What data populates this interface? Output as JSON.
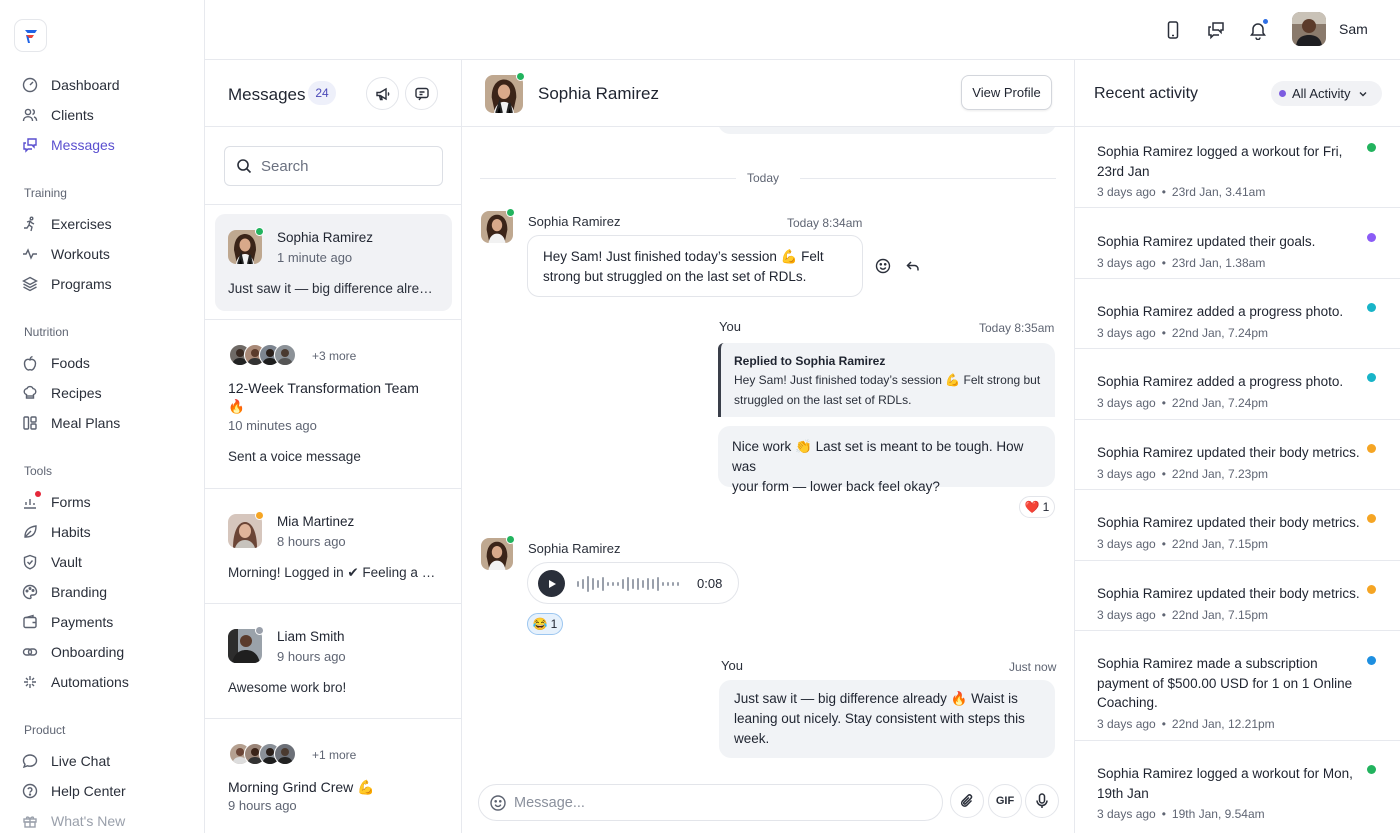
{
  "app": {
    "user_name": "Sam"
  },
  "sidebar": {
    "main": [
      {
        "label": "Dashboard"
      },
      {
        "label": "Clients"
      },
      {
        "label": "Messages"
      }
    ],
    "sections": [
      {
        "title": "Training",
        "items": [
          {
            "label": "Exercises"
          },
          {
            "label": "Workouts"
          },
          {
            "label": "Programs"
          }
        ]
      },
      {
        "title": "Nutrition",
        "items": [
          {
            "label": "Foods"
          },
          {
            "label": "Recipes"
          },
          {
            "label": "Meal Plans"
          }
        ]
      },
      {
        "title": "Tools",
        "items": [
          {
            "label": "Forms"
          },
          {
            "label": "Habits"
          },
          {
            "label": "Vault"
          },
          {
            "label": "Branding"
          },
          {
            "label": "Payments"
          },
          {
            "label": "Onboarding"
          },
          {
            "label": "Automations"
          }
        ]
      },
      {
        "title": "Product",
        "items": [
          {
            "label": "Live Chat"
          },
          {
            "label": "Help Center"
          },
          {
            "label": "What's New"
          }
        ]
      }
    ]
  },
  "messages_panel": {
    "title": "Messages",
    "count": "24",
    "search_placeholder": "Search",
    "conversations": [
      {
        "name": "Sophia Ramirez",
        "time": "1 minute ago",
        "snippet": "Just saw it — big difference already 🔥 Waist is leaning out nicely.",
        "status_color": "#22b35e"
      },
      {
        "more": "+3 more",
        "name": "12-Week Transformation Team",
        "emoji": "🔥",
        "time": "10 minutes ago",
        "snippet": "Sent a voice message"
      },
      {
        "name": "Mia Martinez",
        "time": "8 hours ago",
        "snippet": "Morning! Logged in ✔ Feeling a bit sore today.",
        "status_color": "#f5a524"
      },
      {
        "name": "Liam Smith",
        "time": "9 hours ago",
        "snippet": "Awesome work bro!",
        "status_color": "#9aa0ab"
      },
      {
        "more": "+1 more",
        "name": "Morning Grind Crew 💪",
        "time": "9 hours ago",
        "snippet": ""
      }
    ]
  },
  "chat": {
    "contact_name": "Sophia Ramirez",
    "view_profile_label": "View Profile",
    "day_label": "Today",
    "messages": [
      {
        "sender": "Sophia Ramirez",
        "time": "Today 8:34am",
        "line1": "Hey Sam! Just finished today’s session 💪 Felt",
        "line2": "strong but struggled on the last set of RDLs."
      },
      {
        "sender": "You",
        "time": "Today 8:35am",
        "reply_title": "Replied to Sophia Ramirez",
        "reply_line1": "Hey Sam! Just finished today’s session 💪 Felt strong but",
        "reply_line2": "struggled on the last set of RDLs.",
        "line1": "Nice work 👏 Last set is meant to be tough. How was",
        "line2": "your form — lower back feel okay?",
        "reaction_emoji": "❤️",
        "reaction_count": "1"
      },
      {
        "sender": "Sophia Ramirez",
        "voice_duration": "0:08",
        "reaction_emoji": "😂",
        "reaction_count": "1"
      },
      {
        "sender": "You",
        "time": "Just now",
        "line1": "Just saw it — big difference already 🔥 Waist is",
        "line2": "leaning out nicely. Stay consistent with steps this",
        "line3": "week."
      }
    ],
    "composer_placeholder": "Message...",
    "gif_label": "GIF"
  },
  "activity": {
    "title": "Recent activity",
    "filter_label": "All Activity",
    "filter_dot_color": "#7c5ce0",
    "items": [
      {
        "text": "Sophia Ramirez logged a workout for Fri, 23rd Jan",
        "ago": "3 days ago",
        "date": "23rd Jan, 3.41am",
        "color": "#22b35e"
      },
      {
        "text": "Sophia Ramirez updated their goals.",
        "ago": "3 days ago",
        "date": "23rd Jan, 1.38am",
        "color": "#8b5cf6"
      },
      {
        "text": "Sophia Ramirez added a progress photo.",
        "ago": "3 days ago",
        "date": "22nd Jan, 7.24pm",
        "color": "#18b4c8"
      },
      {
        "text": "Sophia Ramirez added a progress photo.",
        "ago": "3 days ago",
        "date": "22nd Jan, 7.24pm",
        "color": "#18b4c8"
      },
      {
        "text": "Sophia Ramirez updated their body metrics.",
        "ago": "3 days ago",
        "date": "22nd Jan, 7.23pm",
        "color": "#f5a524"
      },
      {
        "text": "Sophia Ramirez updated their body metrics.",
        "ago": "3 days ago",
        "date": "22nd Jan, 7.15pm",
        "color": "#f5a524"
      },
      {
        "text": "Sophia Ramirez updated their body metrics.",
        "ago": "3 days ago",
        "date": "22nd Jan, 7.15pm",
        "color": "#f5a524"
      },
      {
        "text": "Sophia Ramirez made a subscription payment of $500.00 USD for 1 on 1 Online Coaching.",
        "ago": "3 days ago",
        "date": "22nd Jan, 12.21pm",
        "color": "#1e8fe0"
      },
      {
        "text": "Sophia Ramirez logged a workout for Mon, 19th Jan",
        "ago": "3 days ago",
        "date": "19th Jan, 9.54am",
        "color": "#22b35e"
      }
    ]
  }
}
